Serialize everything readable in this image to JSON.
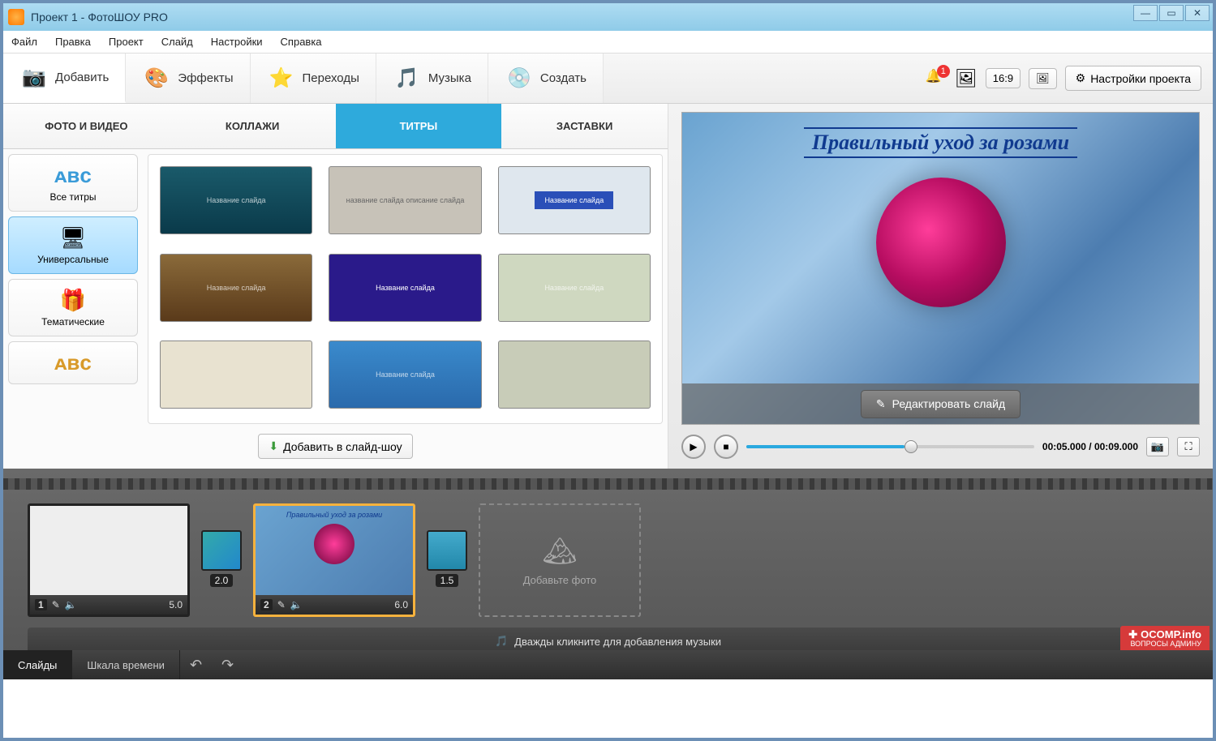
{
  "window": {
    "title": "Проект 1 - ФотоШОУ PRO"
  },
  "menu": [
    "Файл",
    "Правка",
    "Проект",
    "Слайд",
    "Настройки",
    "Справка"
  ],
  "maintabs": {
    "add": "Добавить",
    "effects": "Эффекты",
    "transitions": "Переходы",
    "music": "Музыка",
    "create": "Создать"
  },
  "right_toolbar": {
    "notif_count": "1",
    "aspect": "16:9",
    "settings": "Настройки проекта"
  },
  "subtabs": {
    "photo_video": "ФОТО И ВИДЕО",
    "collages": "КОЛЛАЖИ",
    "titles": "ТИТРЫ",
    "intros": "ЗАСТАВКИ"
  },
  "categories": {
    "all": "Все титры",
    "universal": "Универсальные",
    "themed": "Тематические"
  },
  "thumbs": [
    "Название слайда",
    "название слайда\nописание слайда",
    "Название слайда",
    "Название слайда",
    "Название слайда",
    "Название слайда",
    "",
    "Название слайда",
    ""
  ],
  "add_button": "Добавить в слайд-шоу",
  "preview": {
    "title_text": "Правильный уход за розами",
    "edit": "Редактировать слайд"
  },
  "player": {
    "current": "00:05.000",
    "total": "00:09.000"
  },
  "timeline": {
    "slide1": {
      "num": "1",
      "dur": "5.0"
    },
    "trans1": "2.0",
    "slide2": {
      "num": "2",
      "dur": "6.0",
      "text": "Правильный уход за розами"
    },
    "trans2": "1.5",
    "add_photo": "Добавьте фото",
    "music_hint": "Дважды кликните для добавления музыки",
    "tab_slides": "Слайды",
    "tab_timescale": "Шкала времени"
  },
  "watermark": {
    "site": "OCOMP.info",
    "sub": "ВОПРОСЫ АДМИНУ"
  }
}
